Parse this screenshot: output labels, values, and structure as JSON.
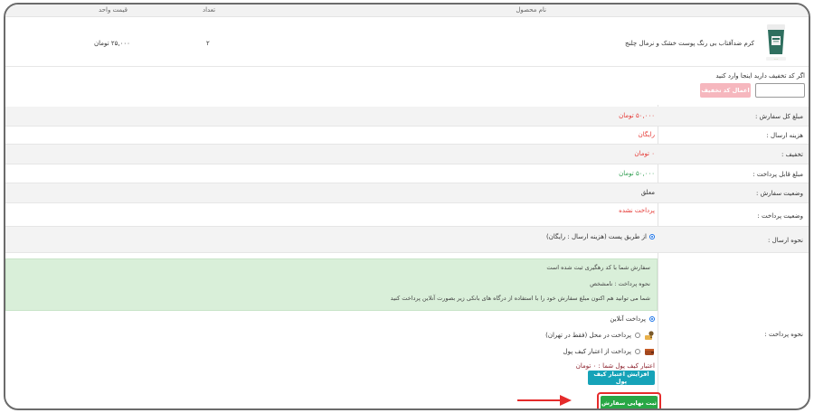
{
  "table": {
    "headers": {
      "product_name": "نام محصول",
      "quantity": "تعداد",
      "unit_price": "قیمت واحد"
    },
    "row": {
      "name": "کرم ضدآفتاب بی رنگ پوست خشک و نرمال چلنج",
      "quantity": "۲",
      "unit_price": "۲۵,۰۰۰ تومان"
    }
  },
  "coupon": {
    "prompt": "اگر کد تخفیف دارید اینجا وارد کنید",
    "input_value": "",
    "apply_label": "اعمال کد تخفیف"
  },
  "summary": {
    "total_label": "مبلغ کل سفارش :",
    "total_value": "۵۰,۰۰۰ تومان",
    "shipping_label": "هزینه ارسال :",
    "shipping_value": "رایگان",
    "discount_label": "تخفیف :",
    "discount_value": "۰ تومان",
    "payable_label": "مبلغ قابل پرداخت :",
    "payable_value": "۵۰,۰۰۰ تومان",
    "order_status_label": "وضعیت سفارش :",
    "order_status_value": "معلق",
    "payment_status_label": "وضعیت پرداخت :",
    "payment_status_value": "پرداخت نشده"
  },
  "shipping": {
    "label": "نحوه ارسال :",
    "option": "از طریق پست (هزینه ارسال : رایگان)"
  },
  "payment": {
    "label": "نحوه پرداخت :",
    "alert_line1": "سفارش شما با کد رهگیری ثبت شده است",
    "alert_line2": "نحوه پرداخت : نامشخص",
    "alert_line3": "شما می توانید هم اکنون مبلغ سفارش خود را با استفاده از درگاه های بانکی زیر بصورت آنلاین پرداخت کنید",
    "option_online": "پرداخت آنلاین",
    "option_cod": "پرداخت در محل (فقط در تهران)",
    "option_wallet": "پرداخت از اعتبار کیف پول",
    "wallet_balance": "اعتبار کیف پول شما : ۰ تومان",
    "wallet_button": "افزایش اعتبار کیف پول",
    "submit_button": "ثبت نهایی سفارش"
  },
  "colors": {
    "accent_red": "#e53935",
    "accent_green": "#28a745",
    "wallet_teal": "#16a3b8",
    "alert_bg": "#d9efd9"
  },
  "icons": [
    "product-thumbnail",
    "cod-pin-icon",
    "wallet-icon",
    "arrow-right-icon"
  ]
}
